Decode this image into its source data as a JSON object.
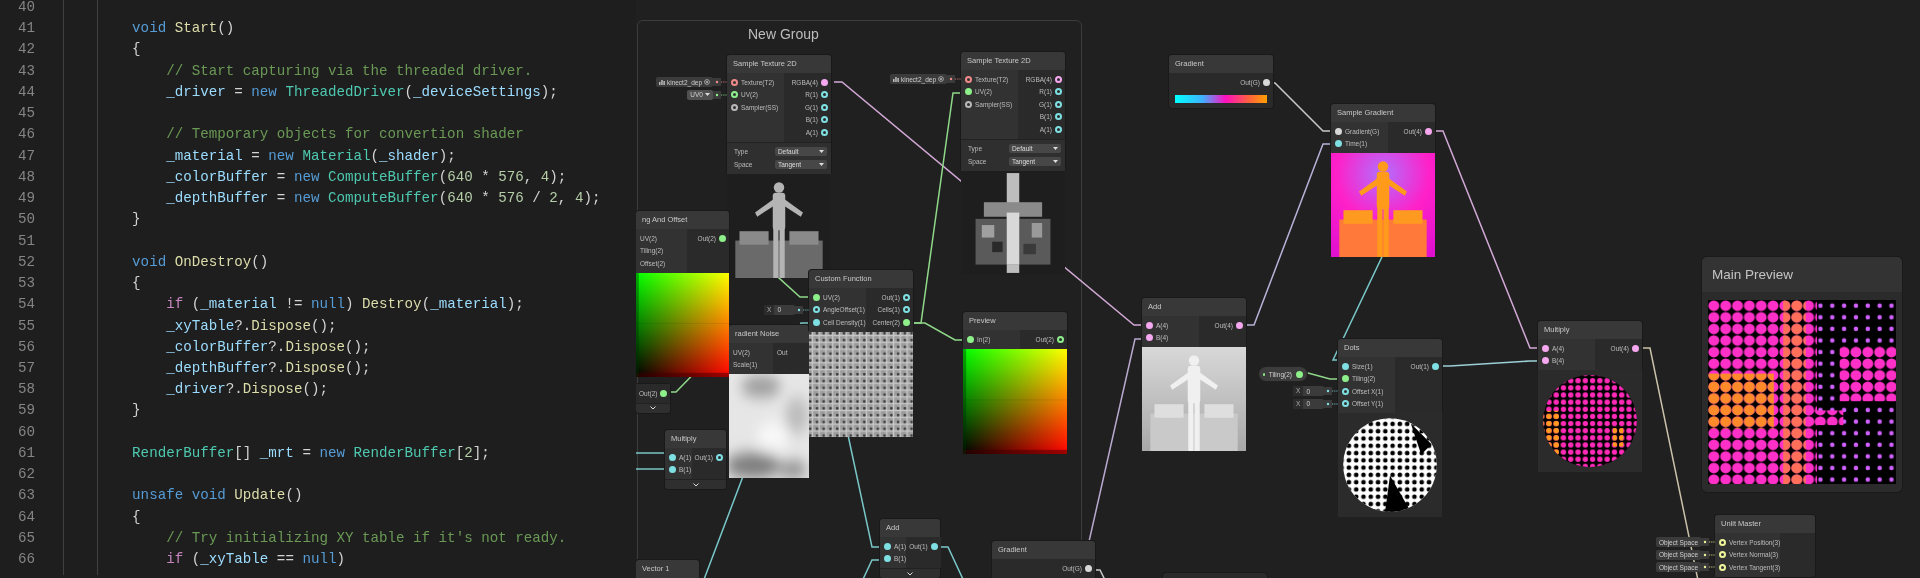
{
  "editor": {
    "lines": [
      {
        "number": "40"
      },
      {
        "number": "41",
        "tokens": [
          {
            "kind": "keyword",
            "text": "        void "
          },
          {
            "kind": "function",
            "text": "Start"
          },
          {
            "kind": "plain",
            "text": "()"
          }
        ]
      },
      {
        "number": "42",
        "tokens": [
          {
            "kind": "plain",
            "text": "        {"
          }
        ]
      },
      {
        "number": "43",
        "tokens": [
          {
            "kind": "comment",
            "text": "            // Start capturing via the threaded driver."
          }
        ]
      },
      {
        "number": "44",
        "tokens": [
          {
            "kind": "variable",
            "text": "            _driver"
          },
          {
            "kind": "plain",
            "text": " = "
          },
          {
            "kind": "keyword",
            "text": "new "
          },
          {
            "kind": "type",
            "text": "ThreadedDriver"
          },
          {
            "kind": "plain",
            "text": "("
          },
          {
            "kind": "variable",
            "text": "_deviceSettings"
          },
          {
            "kind": "plain",
            "text": ");"
          }
        ]
      },
      {
        "number": "45"
      },
      {
        "number": "46",
        "tokens": [
          {
            "kind": "comment",
            "text": "            // Temporary objects for convertion shader"
          }
        ]
      },
      {
        "number": "47",
        "tokens": [
          {
            "kind": "variable",
            "text": "            _material"
          },
          {
            "kind": "plain",
            "text": " = "
          },
          {
            "kind": "keyword",
            "text": "new "
          },
          {
            "kind": "type",
            "text": "Material"
          },
          {
            "kind": "plain",
            "text": "("
          },
          {
            "kind": "variable",
            "text": "_shader"
          },
          {
            "kind": "plain",
            "text": ");"
          }
        ]
      },
      {
        "number": "48",
        "tokens": [
          {
            "kind": "variable",
            "text": "            _colorBuffer"
          },
          {
            "kind": "plain",
            "text": " = "
          },
          {
            "kind": "keyword",
            "text": "new "
          },
          {
            "kind": "type",
            "text": "ComputeBuffer"
          },
          {
            "kind": "plain",
            "text": "("
          },
          {
            "kind": "number",
            "text": "640"
          },
          {
            "kind": "plain",
            "text": " * "
          },
          {
            "kind": "number",
            "text": "576"
          },
          {
            "kind": "plain",
            "text": ", "
          },
          {
            "kind": "number",
            "text": "4"
          },
          {
            "kind": "plain",
            "text": ");"
          }
        ]
      },
      {
        "number": "49",
        "tokens": [
          {
            "kind": "variable",
            "text": "            _depthBuffer"
          },
          {
            "kind": "plain",
            "text": " = "
          },
          {
            "kind": "keyword",
            "text": "new "
          },
          {
            "kind": "type",
            "text": "ComputeBuffer"
          },
          {
            "kind": "plain",
            "text": "("
          },
          {
            "kind": "number",
            "text": "640"
          },
          {
            "kind": "plain",
            "text": " * "
          },
          {
            "kind": "number",
            "text": "576"
          },
          {
            "kind": "plain",
            "text": " / "
          },
          {
            "kind": "number",
            "text": "2"
          },
          {
            "kind": "plain",
            "text": ", "
          },
          {
            "kind": "number",
            "text": "4"
          },
          {
            "kind": "plain",
            "text": ");"
          }
        ]
      },
      {
        "number": "50",
        "tokens": [
          {
            "kind": "plain",
            "text": "        }"
          }
        ]
      },
      {
        "number": "51"
      },
      {
        "number": "52",
        "tokens": [
          {
            "kind": "keyword",
            "text": "        void "
          },
          {
            "kind": "function",
            "text": "OnDestroy"
          },
          {
            "kind": "plain",
            "text": "()"
          }
        ]
      },
      {
        "number": "53",
        "tokens": [
          {
            "kind": "plain",
            "text": "        {"
          }
        ]
      },
      {
        "number": "54",
        "tokens": [
          {
            "kind": "control",
            "text": "            if "
          },
          {
            "kind": "plain",
            "text": "("
          },
          {
            "kind": "variable",
            "text": "_material"
          },
          {
            "kind": "plain",
            "text": " != "
          },
          {
            "kind": "keyword",
            "text": "null"
          },
          {
            "kind": "plain",
            "text": ") "
          },
          {
            "kind": "function",
            "text": "Destroy"
          },
          {
            "kind": "plain",
            "text": "("
          },
          {
            "kind": "variable",
            "text": "_material"
          },
          {
            "kind": "plain",
            "text": ");"
          }
        ]
      },
      {
        "number": "55",
        "tokens": [
          {
            "kind": "variable",
            "text": "            _xyTable"
          },
          {
            "kind": "plain",
            "text": "?."
          },
          {
            "kind": "function",
            "text": "Dispose"
          },
          {
            "kind": "plain",
            "text": "();"
          }
        ]
      },
      {
        "number": "56",
        "tokens": [
          {
            "kind": "variable",
            "text": "            _colorBuffer"
          },
          {
            "kind": "plain",
            "text": "?."
          },
          {
            "kind": "function",
            "text": "Dispose"
          },
          {
            "kind": "plain",
            "text": "();"
          }
        ]
      },
      {
        "number": "57",
        "tokens": [
          {
            "kind": "variable",
            "text": "            _depthBuffer"
          },
          {
            "kind": "plain",
            "text": "?."
          },
          {
            "kind": "function",
            "text": "Dispose"
          },
          {
            "kind": "plain",
            "text": "();"
          }
        ]
      },
      {
        "number": "58",
        "tokens": [
          {
            "kind": "variable",
            "text": "            _driver"
          },
          {
            "kind": "plain",
            "text": "?."
          },
          {
            "kind": "function",
            "text": "Dispose"
          },
          {
            "kind": "plain",
            "text": "();"
          }
        ]
      },
      {
        "number": "59",
        "tokens": [
          {
            "kind": "plain",
            "text": "        }"
          }
        ]
      },
      {
        "number": "60"
      },
      {
        "number": "61",
        "tokens": [
          {
            "kind": "type",
            "text": "        RenderBuffer"
          },
          {
            "kind": "plain",
            "text": "[] "
          },
          {
            "kind": "variable",
            "text": "_mrt"
          },
          {
            "kind": "plain",
            "text": " = "
          },
          {
            "kind": "keyword",
            "text": "new "
          },
          {
            "kind": "type",
            "text": "RenderBuffer"
          },
          {
            "kind": "plain",
            "text": "["
          },
          {
            "kind": "number",
            "text": "2"
          },
          {
            "kind": "plain",
            "text": "];"
          }
        ]
      },
      {
        "number": "62"
      },
      {
        "number": "63",
        "tokens": [
          {
            "kind": "keyword",
            "text": "        unsafe void "
          },
          {
            "kind": "function",
            "text": "Update"
          },
          {
            "kind": "plain",
            "text": "()"
          }
        ]
      },
      {
        "number": "64",
        "tokens": [
          {
            "kind": "plain",
            "text": "        {"
          }
        ]
      },
      {
        "number": "65",
        "tokens": [
          {
            "kind": "comment",
            "text": "            // Try initializing XY table if it's not ready."
          }
        ]
      },
      {
        "number": "66",
        "tokens": [
          {
            "kind": "control",
            "text": "            if "
          },
          {
            "kind": "plain",
            "text": "("
          },
          {
            "kind": "variable",
            "text": "_xyTable"
          },
          {
            "kind": "plain",
            "text": " == "
          },
          {
            "kind": "keyword",
            "text": "null"
          },
          {
            "kind": "plain",
            "text": ")"
          }
        ]
      }
    ]
  },
  "graph": {
    "group": {
      "title": "New Group"
    },
    "nodes": [
      {
        "kind": "node",
        "title": "Sample Texture 2D",
        "inputs": [
          {
            "label": "Texture(T2)",
            "color": "#f08a8a",
            "connected": false,
            "field": {
              "kind": "texture",
              "text": "kinect2_dep"
            }
          },
          {
            "label": "UV(2)",
            "color": "#8ef08a",
            "connected": false,
            "field": {
              "kind": "dropdown",
              "text": "UV0"
            }
          },
          {
            "label": "Sampler(SS)",
            "color": "#b8b8b8",
            "connected": false
          }
        ],
        "outputs": [
          {
            "label": "RGBA(4)",
            "color": "#f5a8f0",
            "connected": true
          },
          {
            "label": "R(1)",
            "color": "#7fe0e3",
            "connected": false
          },
          {
            "label": "G(1)",
            "color": "#7fe0e3",
            "connected": false
          },
          {
            "label": "B(1)",
            "color": "#7fe0e3",
            "connected": false
          },
          {
            "label": "A(1)",
            "color": "#7fe0e3",
            "connected": false
          }
        ],
        "controls": [
          {
            "label": "Type",
            "value": "Default"
          },
          {
            "label": "Space",
            "value": "Tangent"
          }
        ],
        "preview": {
          "kind": "picture"
        }
      },
      {
        "kind": "node",
        "title": "Sample Texture 2D",
        "inputs": [
          {
            "label": "Texture(T2)",
            "color": "#f08a8a",
            "connected": false,
            "field": {
              "kind": "texture",
              "text": "kinect2_dep"
            }
          },
          {
            "label": "UV(2)",
            "color": "#8ef08a",
            "connected": true
          },
          {
            "label": "Sampler(SS)",
            "color": "#b8b8b8",
            "connected": false
          }
        ],
        "outputs": [
          {
            "label": "RGBA(4)",
            "color": "#f5a8f0",
            "connected": false
          },
          {
            "label": "R(1)",
            "color": "#7fe0e3",
            "connected": false
          },
          {
            "label": "G(1)",
            "color": "#7fe0e3",
            "connected": false
          },
          {
            "label": "B(1)",
            "color": "#7fe0e3",
            "connected": false
          },
          {
            "label": "A(1)",
            "color": "#7fe0e3",
            "connected": false
          }
        ],
        "controls": [
          {
            "label": "Type",
            "value": "Default"
          },
          {
            "label": "Space",
            "value": "Tangent"
          }
        ],
        "preview": {
          "kind": "picture"
        }
      },
      {
        "kind": "node",
        "title": "ng And Offset",
        "inputs": [
          {
            "label": "UV(2)"
          },
          {
            "label": "Tiling(2)"
          },
          {
            "label": "Offset(2)"
          }
        ],
        "outputs": [
          {
            "label": "Out(2)",
            "color": "#8ef08a",
            "connected": true
          }
        ],
        "preview": {
          "kind": "picture"
        }
      },
      {
        "kind": "node",
        "outputs": [
          {
            "label": "Out(2)",
            "color": "#8ef08a",
            "connected": true
          }
        ],
        "collapsible": true
      },
      {
        "kind": "node",
        "title": "radient Noise",
        "inputs": [
          {
            "label": "UV(2)"
          },
          {
            "label": "Scale(1)"
          }
        ],
        "outputs": [
          {
            "label": "Out"
          }
        ],
        "preview": {
          "kind": "picture"
        }
      },
      {
        "kind": "node",
        "title": "Multiply",
        "inputs": [
          {
            "label": "A(1)",
            "color": "#7fe0e3",
            "connected": true
          },
          {
            "label": "B(1)",
            "color": "#7fe0e3",
            "connected": true
          }
        ],
        "outputs": [
          {
            "label": "Out(1)",
            "color": "#7fe0e3",
            "connected": false
          }
        ],
        "collapsible": true
      },
      {
        "kind": "node",
        "title": "Custom Function",
        "inputs": [
          {
            "label": "UV(2)",
            "color": "#8ef08a",
            "connected": true
          },
          {
            "label": "AngleOffset(1)",
            "color": "#7fe0e3",
            "connected": false,
            "field": {
              "kind": "number",
              "label": "X",
              "text": "0"
            }
          },
          {
            "label": "Cell Density(1)",
            "color": "#7fe0e3",
            "connected": true
          }
        ],
        "outputs": [
          {
            "label": "Out(1)",
            "color": "#7fe0e3",
            "connected": false
          },
          {
            "label": "Cells(1)",
            "color": "#7fe0e3",
            "connected": false
          },
          {
            "label": "Center(2)",
            "color": "#8ef08a",
            "connected": true
          }
        ],
        "preview": {
          "kind": "picture"
        }
      },
      {
        "kind": "node",
        "title": "Preview",
        "inputs": [
          {
            "label": "In(2)",
            "color": "#8ef08a",
            "connected": true
          }
        ],
        "outputs": [
          {
            "label": "Out(2)",
            "color": "#8ef08a",
            "connected": false
          }
        ],
        "preview": {
          "kind": "picture"
        }
      },
      {
        "kind": "node",
        "title": "Add",
        "inputs": [
          {
            "label": "A(1)",
            "color": "#7fe0e3",
            "connected": true
          },
          {
            "label": "B(1)",
            "color": "#7fe0e3",
            "connected": true
          }
        ],
        "outputs": [
          {
            "label": "Out(1)",
            "color": "#7fe0e3",
            "connected": true
          }
        ],
        "collapsible": true
      },
      {
        "kind": "node",
        "title": "Vector 1"
      },
      {
        "kind": "node",
        "title": "Gradient",
        "outputs": [
          {
            "label": "Out(G)",
            "color": "#d8d8d8",
            "connected": true
          }
        ]
      },
      {
        "kind": "node",
        "title": "Gradient",
        "outputs": [
          {
            "label": "Out(G)",
            "color": "#d8d8d8",
            "connected": true
          }
        ],
        "gradient_bar": true
      },
      {
        "kind": "node",
        "title": "Sample Gradient",
        "inputs": [
          {
            "label": "Gradient(G)",
            "color": "#d8d8d8",
            "connected": true
          },
          {
            "label": "Time(1)",
            "color": "#7fe0e3",
            "connected": true
          }
        ],
        "outputs": [
          {
            "label": "Out(4)",
            "color": "#f5a8f0",
            "connected": true
          }
        ],
        "preview": {
          "kind": "picture"
        }
      },
      {
        "kind": "node",
        "title": "Add",
        "inputs": [
          {
            "label": "A(4)",
            "color": "#f5a8f0",
            "connected": true
          },
          {
            "label": "B(4)",
            "color": "#f5a8f0",
            "connected": true
          }
        ],
        "outputs": [
          {
            "label": "Out(4)",
            "color": "#f5a8f0",
            "connected": true
          }
        ],
        "preview": {
          "kind": "picture"
        }
      },
      {
        "kind": "property",
        "label": "Tiling(2)",
        "color": "#8ef08a",
        "connected": true
      },
      {
        "kind": "node",
        "title": "Dots",
        "inputs": [
          {
            "label": "Size(1)",
            "color": "#7fe0e3",
            "connected": true
          },
          {
            "label": "Tiling(2)",
            "color": "#8ef08a",
            "connected": true
          },
          {
            "label": "Offset X(1)",
            "color": "#7fe0e3",
            "connected": false,
            "field": {
              "kind": "number",
              "label": "X",
              "text": "0"
            }
          },
          {
            "label": "Offset Y(1)",
            "color": "#7fe0e3",
            "connected": false,
            "field": {
              "kind": "number",
              "label": "X",
              "text": "0"
            }
          }
        ],
        "outputs": [
          {
            "label": "Out(1)",
            "color": "#7fe0e3",
            "connected": true
          }
        ],
        "preview": {
          "kind": "picture"
        }
      },
      {
        "kind": "node",
        "title": "Multiply",
        "inputs": [
          {
            "label": "A(4)",
            "color": "#f5a8f0",
            "connected": true
          },
          {
            "label": "B(4)",
            "color": "#f5a8f0",
            "connected": true
          }
        ],
        "outputs": [
          {
            "label": "Out(4)",
            "color": "#f5a8f0",
            "connected": true
          }
        ],
        "preview": {
          "kind": "picture"
        }
      },
      {
        "kind": "node",
        "title": "Unlit Master",
        "inputs": [
          {
            "label": "Vertex Position(3)",
            "color": "#eef59a",
            "connected": false,
            "field": {
              "kind": "space",
              "text": "Object Space"
            }
          },
          {
            "label": "Vertex Normal(3)",
            "color": "#eef59a",
            "connected": false,
            "field": {
              "kind": "space",
              "text": "Object Space"
            }
          },
          {
            "label": "Vertex Tangent(3)",
            "color": "#eef59a",
            "connected": false,
            "field": {
              "kind": "space",
              "text": "Object Space"
            }
          }
        ]
      },
      {
        "kind": "node"
      }
    ],
    "main_preview": {
      "title": "Main Preview",
      "preview": {
        "kind": "picture"
      }
    }
  }
}
